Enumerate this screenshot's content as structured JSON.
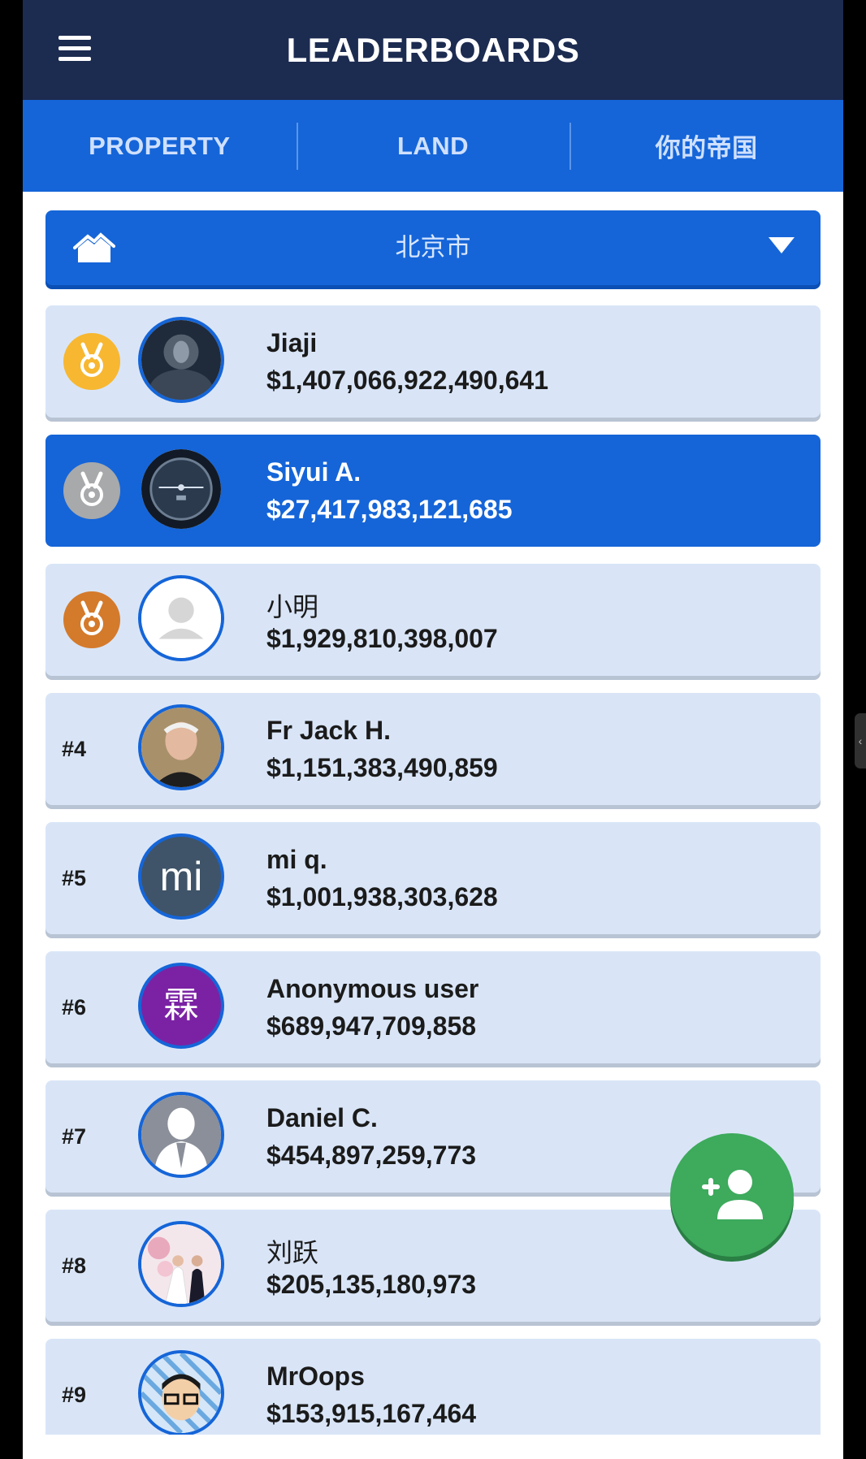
{
  "header": {
    "title": "LEADERBOARDS",
    "menu_icon": "hamburger-menu-icon"
  },
  "tabs": [
    {
      "label": "PROPERTY"
    },
    {
      "label": "LAND"
    },
    {
      "label": "你的帝国"
    }
  ],
  "city_selector": {
    "label": "北京市",
    "icon": "buildings-icon",
    "caret": "chevron-down-icon"
  },
  "leaderboard": [
    {
      "rank": "1",
      "medal": "gold",
      "name": "Jiaji",
      "value": "$1,407,066,922,490,641",
      "avatar": "photo"
    },
    {
      "rank": "2",
      "medal": "silver",
      "name": "Siyui A.",
      "value": "$27,417,983,121,685",
      "avatar": "photo",
      "highlighted": true
    },
    {
      "rank": "3",
      "medal": "bronze",
      "name": "小明",
      "value": "$1,929,810,398,007",
      "avatar": "placeholder"
    },
    {
      "rank": "#4",
      "name": "Fr Jack H.",
      "value": "$1,151,383,490,859",
      "avatar": "photo"
    },
    {
      "rank": "#5",
      "name": "mi q.",
      "value": "$1,001,938,303,628",
      "avatar": "initials",
      "initials": "mi"
    },
    {
      "rank": "#6",
      "name": "Anonymous user",
      "value": "$689,947,709,858",
      "avatar": "initials",
      "initials": "霖"
    },
    {
      "rank": "#7",
      "name": "Daniel C.",
      "value": "$454,897,259,773",
      "avatar": "photo"
    },
    {
      "rank": "#8",
      "name": "刘跃",
      "value": "$205,135,180,973",
      "avatar": "photo"
    },
    {
      "rank": "#9",
      "name": "MrOops",
      "value": "$153,915,167,464",
      "avatar": "photo"
    }
  ],
  "fab": {
    "icon": "add-person-icon"
  },
  "colors": {
    "header_bg": "#1c2b50",
    "primary": "#1565d8",
    "row_bg": "#d9e5f7",
    "gold": "#f7b731",
    "silver": "#a7a9ab",
    "bronze": "#d47a2b",
    "fab": "#3daa5c"
  }
}
